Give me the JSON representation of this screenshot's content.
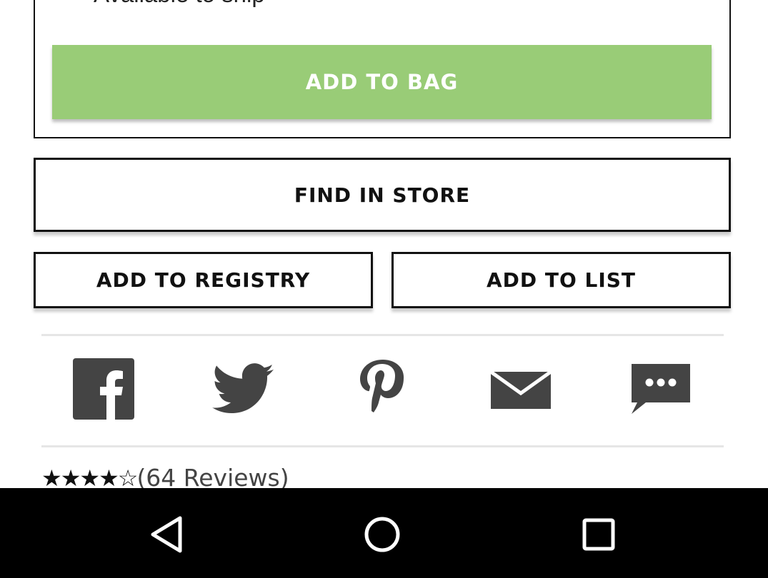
{
  "purchase": {
    "availability_text": "Available to ship",
    "check_icon": "check-icon",
    "add_to_bag_label": "ADD TO BAG",
    "add_to_bag_color": "#99cc77"
  },
  "actions": {
    "find_in_store_label": "FIND IN STORE",
    "add_to_registry_label": "ADD TO REGISTRY",
    "add_to_list_label": "ADD TO LIST"
  },
  "share": {
    "icons": [
      "facebook-icon",
      "twitter-icon",
      "pinterest-icon",
      "email-icon",
      "message-icon"
    ],
    "icon_color": "#444444"
  },
  "rating": {
    "stars": "★★★★☆",
    "value": 4,
    "max": 5,
    "reviews_text": "(64 Reviews)"
  },
  "system_nav": {
    "icons": [
      "back-icon",
      "home-icon",
      "recent-apps-icon"
    ]
  }
}
